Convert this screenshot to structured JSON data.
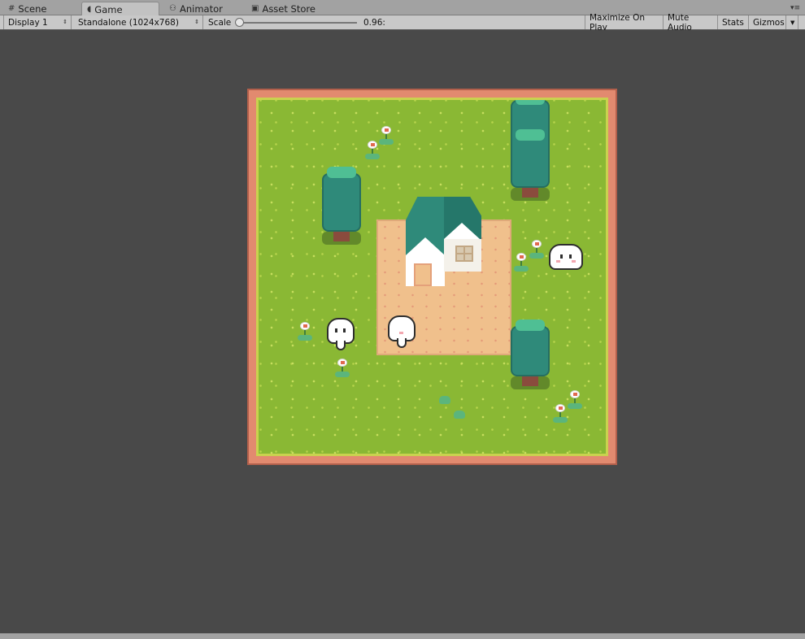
{
  "tabs": [
    {
      "label": "Scene",
      "icon": "grid-icon",
      "active": false
    },
    {
      "label": "Game",
      "icon": "pacman-icon",
      "active": true
    },
    {
      "label": "Animator",
      "icon": "animator-icon",
      "active": false
    },
    {
      "label": "Asset Store",
      "icon": "store-bag-icon",
      "active": false
    }
  ],
  "toolbar": {
    "display": "Display 1",
    "resolution": "Standalone (1024x768)",
    "scale_label": "Scale",
    "scale_value": "0.96:",
    "maximize": "Maximize On Play",
    "mute": "Mute Audio",
    "stats": "Stats",
    "gizmos": "Gizmos"
  },
  "colors": {
    "editor_bg": "#494949",
    "grass": "#8ab834",
    "border": "#e28a6f",
    "dirt": "#f0c08c",
    "tree": "#2f8a7a"
  },
  "scene": {
    "trees": 4,
    "ghosts": 3,
    "flowers": 8
  }
}
